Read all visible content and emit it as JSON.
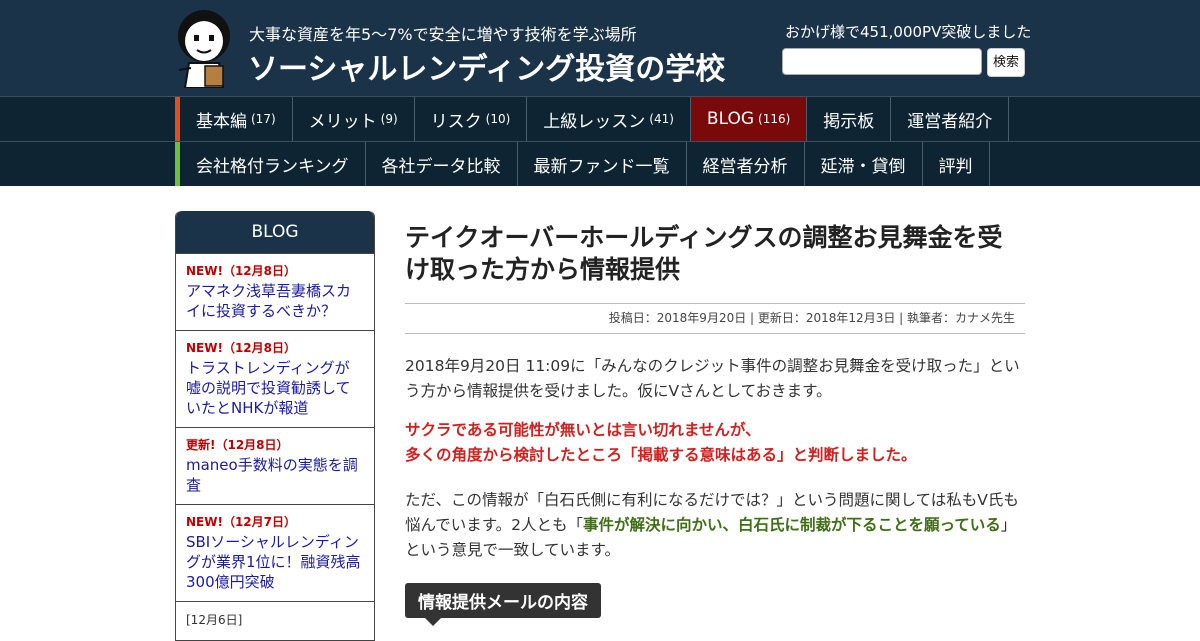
{
  "header": {
    "tagline": "大事な資産を年5～7%で安全に増やす技術を学ぶ場所",
    "site_title": "ソーシャルレンディング投資の学校",
    "pv_notice": "おかげ様で451,000PV突破しました",
    "search_placeholder": "",
    "search_button": "検索",
    "logo_icon": "teacher-mascot-icon"
  },
  "nav_primary": [
    {
      "label": "基本編",
      "count": "(17)"
    },
    {
      "label": "メリット",
      "count": "(9)"
    },
    {
      "label": "リスク",
      "count": "(10)"
    },
    {
      "label": "上級レッスン",
      "count": "(41)"
    },
    {
      "label": "BLOG",
      "count": "(116)",
      "active": true
    },
    {
      "label": "掲示板",
      "count": ""
    },
    {
      "label": "運営者紹介",
      "count": ""
    }
  ],
  "nav_secondary": [
    {
      "label": "会社格付ランキング"
    },
    {
      "label": "各社データ比較"
    },
    {
      "label": "最新ファンド一覧"
    },
    {
      "label": "経営者分析"
    },
    {
      "label": "延滞・貸倒"
    },
    {
      "label": "評判"
    }
  ],
  "sidebar": {
    "title": "BLOG",
    "items": [
      {
        "badge": "NEW!（12月8日）",
        "link": "アマネク浅草吾妻橋スカイに投資するべきか？"
      },
      {
        "badge": "NEW!（12月8日）",
        "link": "トラストレンディングが嘘の説明で投資勧誘していたとNHKが報道"
      },
      {
        "badge": "更新!（12月8日）",
        "link": "maneo手数料の実態を調査"
      },
      {
        "badge": "NEW!（12月7日）",
        "link": "SBIソーシャルレンディングが業界1位に！融資残高300億円突破"
      },
      {
        "badge": "",
        "date": "[12月6日]",
        "link": ""
      }
    ]
  },
  "article": {
    "title": "テイクオーバーホールディングスの調整お見舞金を受け取った方から情報提供",
    "meta": "投稿日：2018年9月20日 | 更新日：2018年12月3日 | 執筆者：カナメ先生",
    "para1": "2018年9月20日 11:09に「みんなのクレジット事件の調整お見舞金を受け取った」という方から情報提供を受けました。仮にVさんとしておきます。",
    "para2_line1": "サクラである可能性が無いとは言い切れませんが、",
    "para2_line2": "多くの角度から検討したところ「掲載する意味はある」と判断しました。",
    "para3_before": "ただ、この情報が「白石氏側に有利になるだけでは？」という問題に関しては私もV氏も悩んでいます。2人とも「",
    "para3_green": "事件が解決に向かい、白石氏に制裁が下ることを願っている",
    "para3_after": "」という意見で一致しています。",
    "section_label": "情報提供メールの内容"
  }
}
